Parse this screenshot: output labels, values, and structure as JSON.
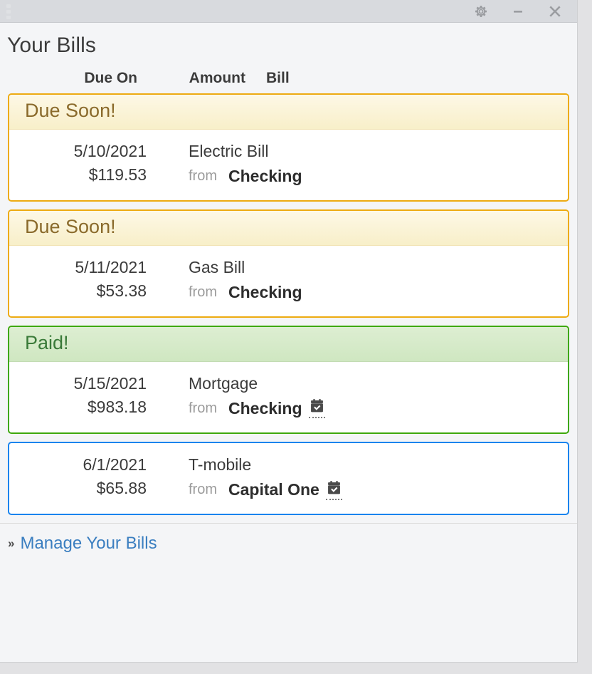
{
  "window": {
    "titlebar": {
      "drag_handle": "drag-handle-icon",
      "buttons": [
        {
          "name": "settings-button",
          "icon": "gear-icon"
        },
        {
          "name": "minimize-button",
          "icon": "minimize-icon"
        },
        {
          "name": "close-button",
          "icon": "close-icon"
        }
      ]
    }
  },
  "header": {
    "title": "Your Bills",
    "columns": {
      "due_on": "Due On",
      "amount": "Amount",
      "bill": "Bill"
    }
  },
  "bills": [
    {
      "status": "Due Soon!",
      "status_type": "due",
      "date": "5/10/2021",
      "amount": "$119.53",
      "name": "Electric Bill",
      "from_label": "from",
      "account": "Checking",
      "has_calendar_icon": false
    },
    {
      "status": "Due Soon!",
      "status_type": "due",
      "date": "5/11/2021",
      "amount": "$53.38",
      "name": "Gas Bill",
      "from_label": "from",
      "account": "Checking",
      "has_calendar_icon": false
    },
    {
      "status": "Paid!",
      "status_type": "paid",
      "date": "5/15/2021",
      "amount": "$983.18",
      "name": "Mortgage",
      "from_label": "from",
      "account": "Checking",
      "has_calendar_icon": true
    },
    {
      "status": "",
      "status_type": "plain",
      "date": "6/1/2021",
      "amount": "$65.88",
      "name": "T-mobile",
      "from_label": "from",
      "account": "Capital One",
      "has_calendar_icon": true
    }
  ],
  "footer": {
    "chevron": "»",
    "link": "Manage Your Bills"
  },
  "colors": {
    "due_border": "#edab12",
    "due_header_bg": "#fdf8e6",
    "due_text": "#8a6a2b",
    "paid_border": "#3ea80c",
    "paid_header_bg": "#ddeed2",
    "paid_text": "#3a7a39",
    "plain_border": "#1a84ee",
    "link": "#3a7ec0",
    "titlebar_bg": "#d8dade",
    "page_bg": "#f4f5f7"
  }
}
